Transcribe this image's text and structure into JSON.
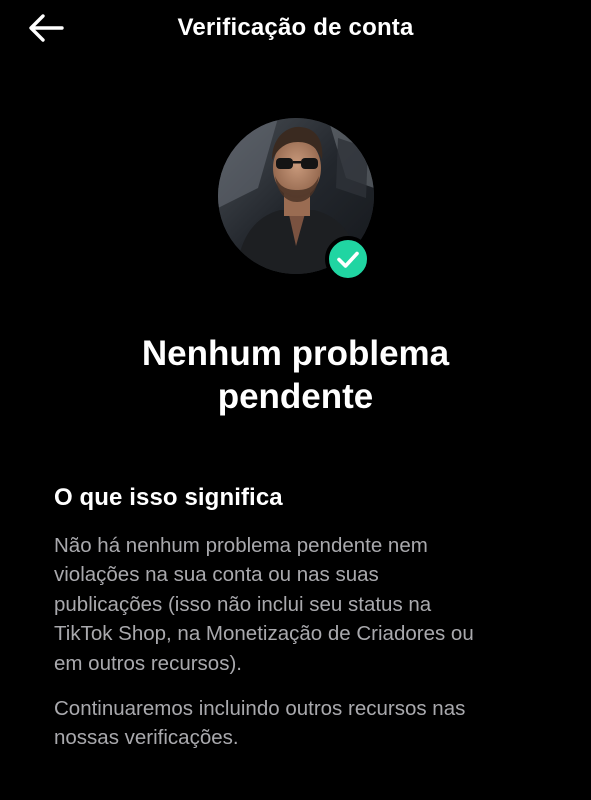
{
  "header": {
    "title": "Verificação de conta",
    "back_icon": "arrow-left-icon"
  },
  "profile": {
    "verified_icon": "check-circle-icon",
    "badge_color": "#20d5a2"
  },
  "status": {
    "title_line1": "Nenhum problema",
    "title_line2": "pendente"
  },
  "meaning": {
    "heading": "O que isso significa",
    "paragraph1": [
      "Não há nenhum problema pendente nem",
      "violações na sua conta ou nas suas",
      "publicações (isso não inclui seu status na",
      "TikTok Shop, na Monetização de Criadores ou",
      "em outros recursos)."
    ],
    "paragraph2": [
      "Continuaremos incluindo outros recursos nas",
      "nossas verificações."
    ]
  },
  "colors": {
    "background": "#000000",
    "text_primary": "#ffffff",
    "text_secondary": "#a9a9ad",
    "accent": "#20d5a2"
  }
}
